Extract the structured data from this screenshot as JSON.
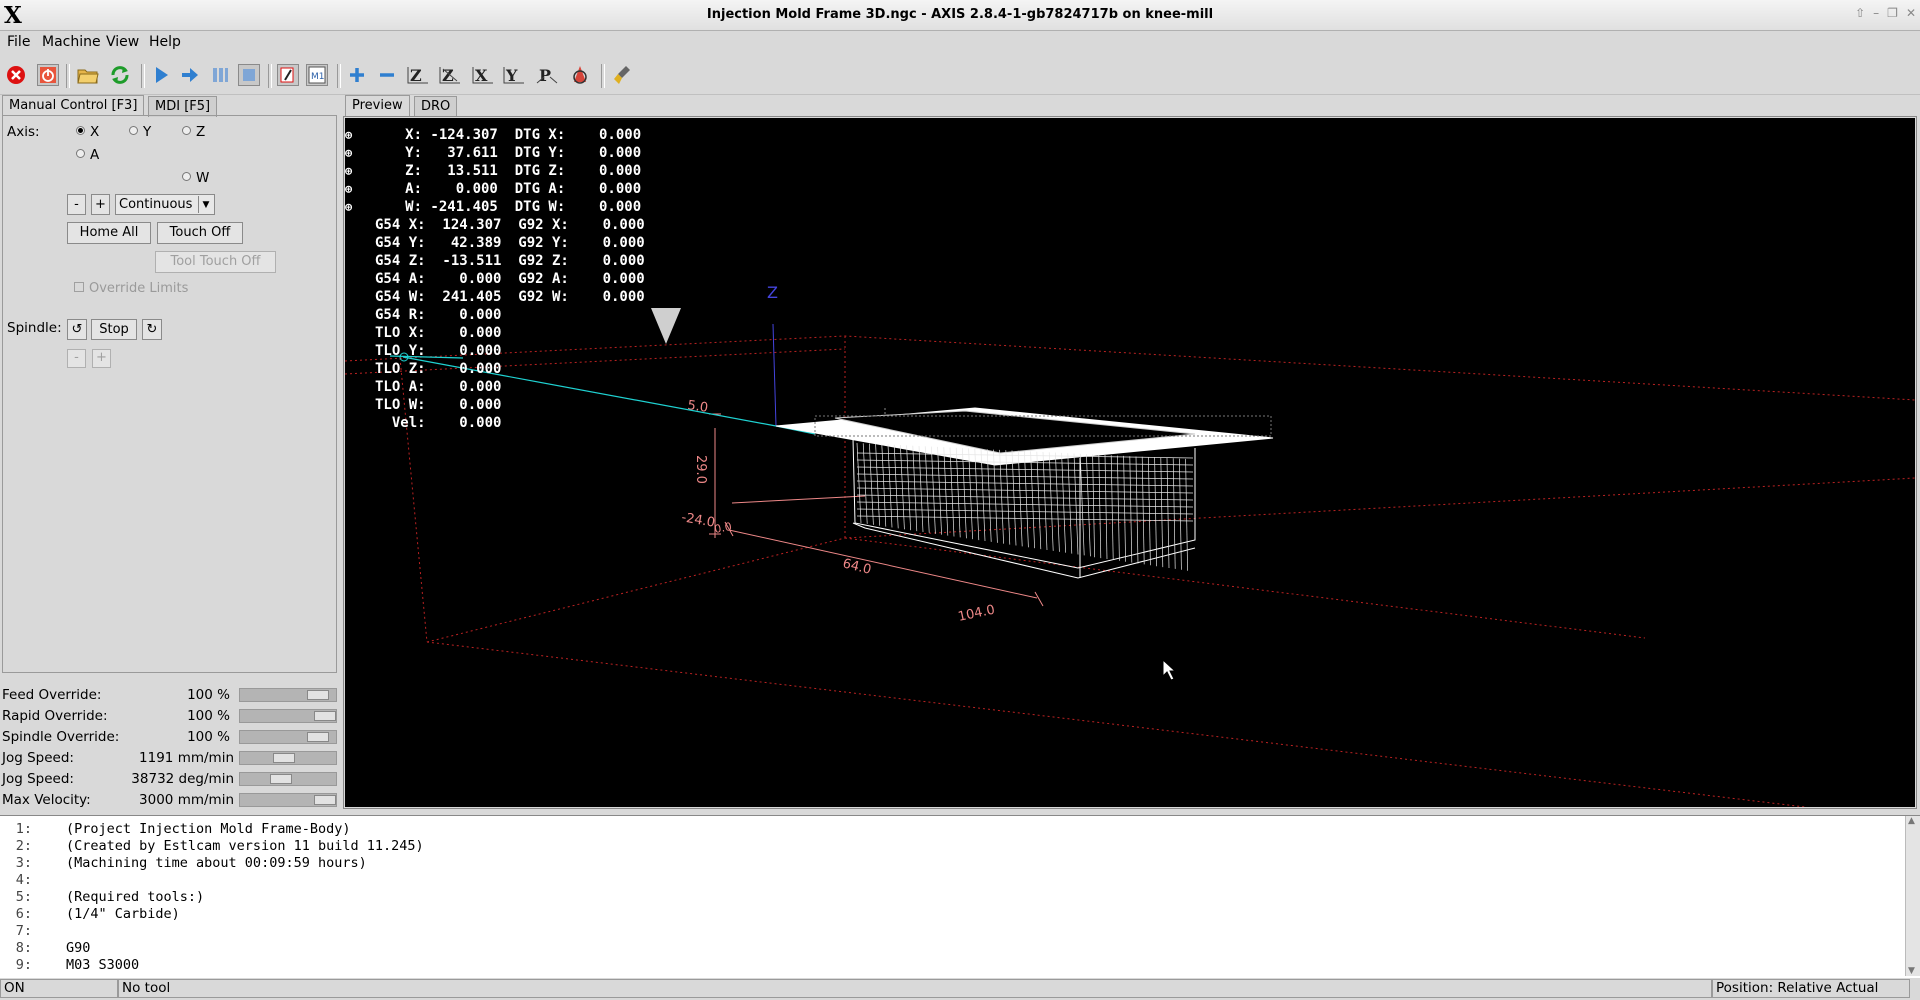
{
  "window": {
    "logo": "X",
    "title": "Injection Mold Frame 3D.ngc - AXIS 2.8.4-1-gb7824717b on knee-mill"
  },
  "menu": [
    "File",
    "Machine",
    "View",
    "Help"
  ],
  "toolbar_icons": [
    "estop-icon",
    "machine-power-icon",
    "open-file-icon",
    "reload-icon",
    "run-icon",
    "step-icon",
    "pause-icon",
    "stop-icon",
    "touch-off-tool-icon",
    "edit-tool-icon",
    "zoom-in-icon",
    "zoom-out-icon",
    "view-z-icon",
    "view-z2-icon",
    "view-x-icon",
    "view-y-icon",
    "view-p-icon",
    "rotate-icon",
    "clear-plot-icon"
  ],
  "left_tabs": {
    "manual": "Manual Control [F3]",
    "mdi": "MDI [F5]"
  },
  "manual": {
    "axis_label": "Axis:",
    "axes": [
      {
        "name": "X",
        "selected": true
      },
      {
        "name": "Y",
        "selected": false
      },
      {
        "name": "Z",
        "selected": false
      },
      {
        "name": "A",
        "selected": false
      },
      {
        "name": "W",
        "selected": false
      }
    ],
    "minus": "-",
    "plus": "+",
    "jog_mode": "Continuous",
    "home_all": "Home All",
    "touch_off": "Touch Off",
    "tool_touch_off": "Tool Touch Off",
    "override_limits": "Override Limits",
    "spindle_label": "Spindle:",
    "spindle_stop": "Stop"
  },
  "sliders": [
    {
      "label": "Feed Override:",
      "value": "100",
      "unit": "%",
      "fraction": 0.9
    },
    {
      "label": "Rapid Override:",
      "value": "100",
      "unit": "%",
      "fraction": 1.0
    },
    {
      "label": "Spindle Override:",
      "value": "100",
      "unit": "%",
      "fraction": 0.9
    },
    {
      "label": "Jog Speed:",
      "value": "1191",
      "unit": "mm/min",
      "fraction": 0.45
    },
    {
      "label": "Jog Speed:",
      "value": "38732",
      "unit": "deg/min",
      "fraction": 0.4
    },
    {
      "label": "Max Velocity:",
      "value": "3000",
      "unit": "mm/min",
      "fraction": 1.0
    }
  ],
  "view_tabs": {
    "preview": "Preview",
    "dro": "DRO"
  },
  "dro": {
    "rows": [
      "     X: -124.307  DTG X:    0.000",
      "     Y:   37.611  DTG Y:    0.000",
      "     Z:   13.511  DTG Z:    0.000",
      "     A:    0.000  DTG A:    0.000",
      "     W: -241.405  DTG W:    0.000",
      "G54 X:  124.307  G92 X:    0.000",
      "G54 Y:   42.389  G92 Y:    0.000",
      "G54 Z:  -13.511  G92 Z:    0.000",
      "G54 A:    0.000  G92 A:    0.000",
      "G54 W:  241.405  G92 W:    0.000",
      "G54 R:    0.000",
      "TLO X:    0.000",
      "TLO Y:    0.000",
      "TLO Z:    0.000",
      "TLO A:    0.000",
      "TLO W:    0.000",
      "  Vel:    0.000"
    ]
  },
  "preview_labels": {
    "z_axis": "Z",
    "dim_top": "5.0",
    "dim_height": "29.0",
    "dim_left": "-24.0",
    "dim_mid": "64.0",
    "dim_length": "104.0",
    "dim_small": "0.0"
  },
  "gcode": [
    {
      "n": "1:",
      "text": "(Project Injection Mold Frame-Body)"
    },
    {
      "n": "2:",
      "text": "(Created by Estlcam version 11 build 11.245)"
    },
    {
      "n": "3:",
      "text": "(Machining time about 00:09:59 hours)"
    },
    {
      "n": "4:",
      "text": ""
    },
    {
      "n": "5:",
      "text": "(Required tools:)"
    },
    {
      "n": "6:",
      "text": "(1/4\" Carbide)"
    },
    {
      "n": "7:",
      "text": ""
    },
    {
      "n": "8:",
      "text": "G90"
    },
    {
      "n": "9:",
      "text": "M03 S3000"
    }
  ],
  "status": {
    "state": "ON",
    "tool": "No tool",
    "position": "Position: Relative Actual"
  }
}
